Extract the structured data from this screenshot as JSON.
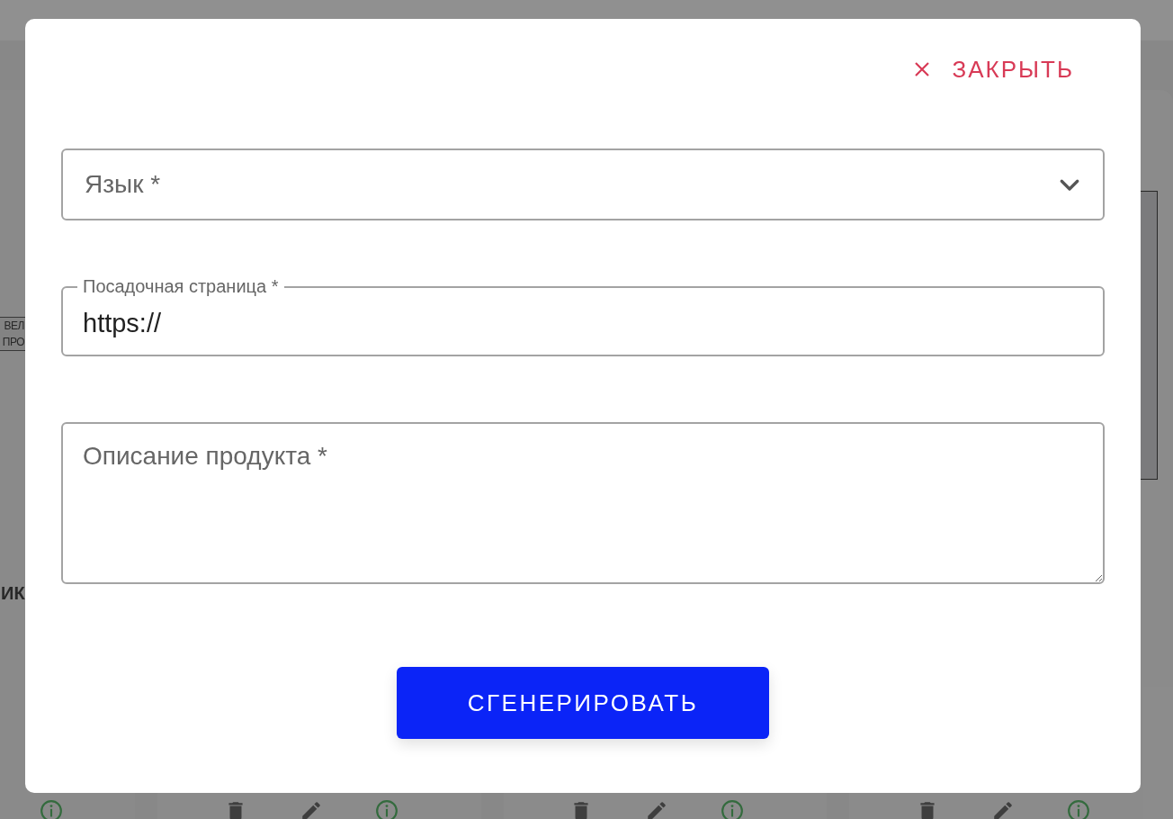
{
  "background": {
    "fragments": [
      {
        "kind": "boxed",
        "lines": [
          "ВЕЛ",
          "ПРО"
        ]
      },
      {
        "kind": "plain",
        "lines": [
          "ИК"
        ]
      }
    ],
    "cards": [
      {
        "actions": [
          {
            "kind": "info"
          }
        ]
      },
      {
        "actions": [
          {
            "kind": "delete"
          },
          {
            "kind": "edit"
          },
          {
            "kind": "info"
          }
        ]
      },
      {
        "actions": [
          {
            "kind": "delete"
          },
          {
            "kind": "edit"
          },
          {
            "kind": "info"
          }
        ]
      },
      {
        "actions": [
          {
            "kind": "delete"
          },
          {
            "kind": "edit"
          },
          {
            "kind": "info"
          }
        ]
      }
    ]
  },
  "dialog": {
    "close_button": "ЗАКРЫТЬ",
    "fields": [
      {
        "kind": "select",
        "placeholder": "Язык *"
      },
      {
        "kind": "text",
        "label": "Посадочная страница *",
        "value": "https://"
      },
      {
        "kind": "textarea",
        "placeholder": "Описание продукта *"
      }
    ],
    "submit_button": "СГЕНЕРИРОВАТЬ"
  }
}
